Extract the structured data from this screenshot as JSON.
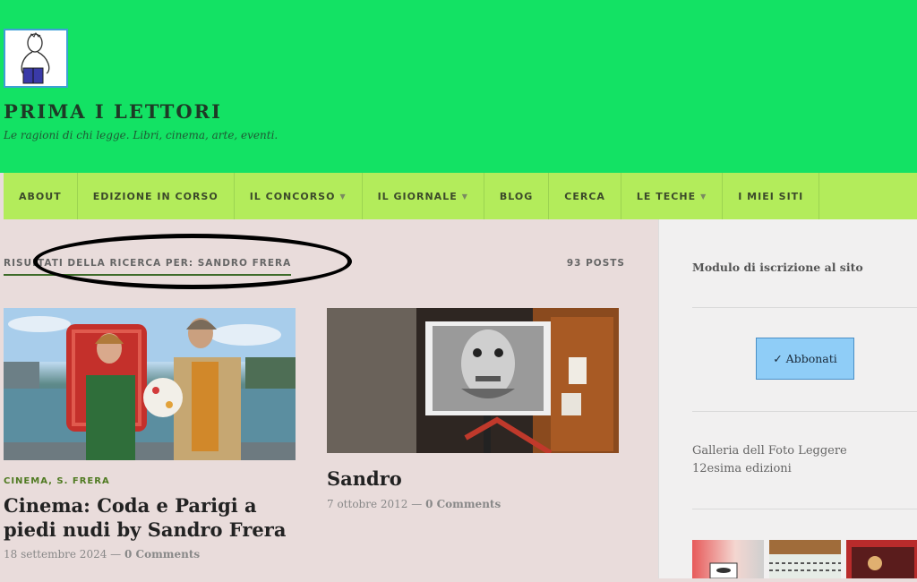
{
  "site": {
    "title": "PRIMA I LETTORI",
    "tagline": "Le ragioni di chi legge. Libri, cinema, arte, eventi."
  },
  "nav": [
    {
      "label": "ABOUT",
      "dropdown": false
    },
    {
      "label": "EDIZIONE IN CORSO",
      "dropdown": false
    },
    {
      "label": "IL CONCORSO",
      "dropdown": true
    },
    {
      "label": "IL GIORNALE",
      "dropdown": true
    },
    {
      "label": "BLOG",
      "dropdown": false
    },
    {
      "label": "CERCA",
      "dropdown": false
    },
    {
      "label": "LE TECHE",
      "dropdown": true
    },
    {
      "label": "I MIEI SITI",
      "dropdown": false
    }
  ],
  "search": {
    "results_label": "RISULTATI DELLA RICERCA PER: SANDRO FRERA",
    "count": "93 POSTS"
  },
  "posts": [
    {
      "categories": "CINEMA, S. FRERA",
      "title": "Cinema: Coda e Parigi a piedi nudi by Sandro Frera",
      "date": "18 settembre 2024",
      "separator": "—",
      "comments": "0 Comments"
    },
    {
      "categories": "",
      "title": "Sandro",
      "date": "7 ottobre 2012",
      "separator": "—",
      "comments": "0 Comments"
    }
  ],
  "sidebar": {
    "signup_title": "Modulo di iscrizione al sito",
    "subscribe_label": "✓ Abbonati",
    "gallery_text": "Galleria dell Foto Leggere 12esima edizioni"
  },
  "colors": {
    "header": "#13e264",
    "nav": "#b3ec5b",
    "content_bg": "#e9dcdb",
    "accent": "#4f7a21",
    "subscribe": "#8fcdf7"
  }
}
